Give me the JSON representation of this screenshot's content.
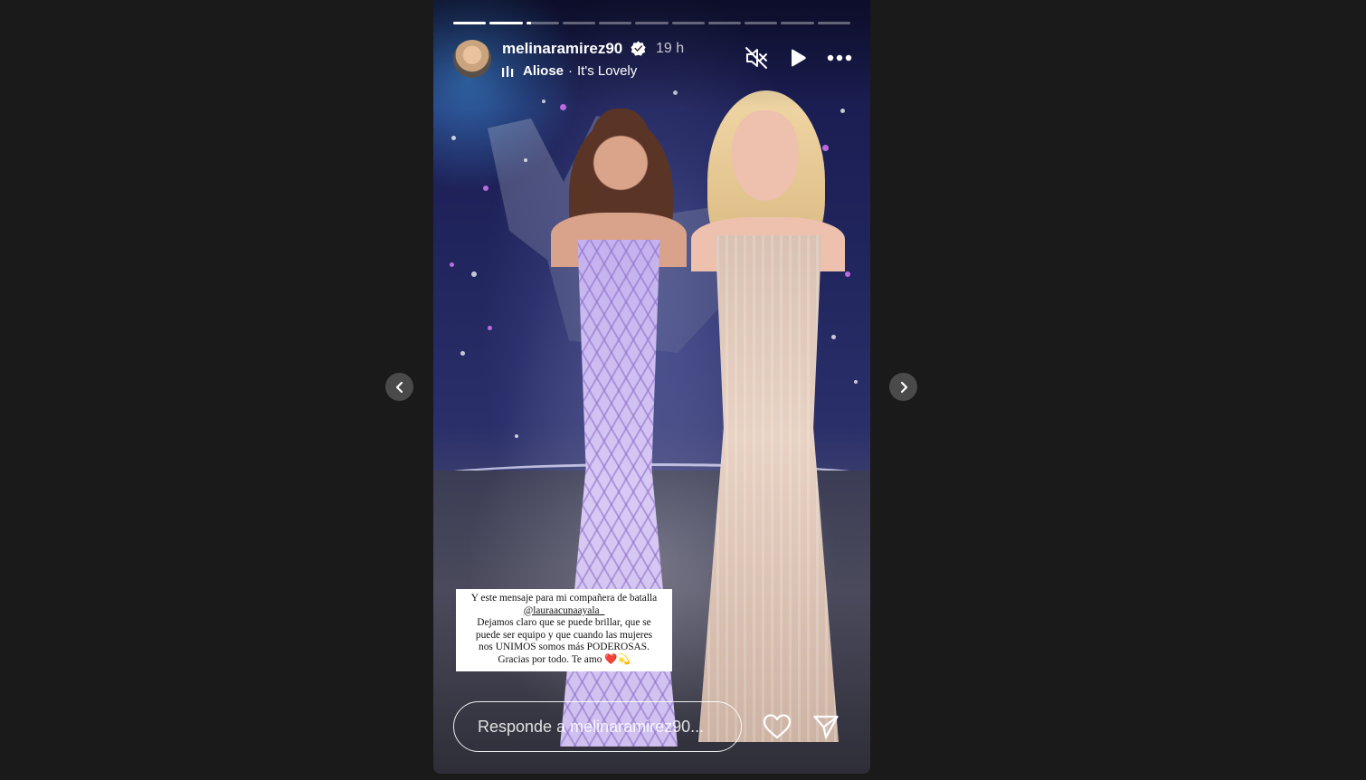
{
  "story": {
    "progress": {
      "segment_count": 11,
      "segments_completed": 2,
      "current_segment_fraction": 0.15
    },
    "header": {
      "username": "melinaramirez90",
      "verified": true,
      "time_ago": "19 h",
      "music": {
        "artist": "Aliose",
        "separator": "·",
        "song": "It's Lovely"
      }
    },
    "controls": {
      "mute_icon": "speaker-muted-icon",
      "play_icon": "play-icon",
      "more_icon": "more-horizontal-icon"
    },
    "caption": {
      "line1": "Y este mensaje para mi compañera de batalla",
      "mention": "@lauraacunaayala_",
      "line3": "Dejamos claro que se puede brillar, que se",
      "line4": "puede ser equipo y que cuando las mujeres",
      "line5": "nos UNIMOS somos más PODEROSAS.",
      "line6": "Gracias por todo. Te amo ❤️💫"
    },
    "reply": {
      "placeholder": "Responde a melinaramirez90..."
    },
    "actions": {
      "like_icon": "heart-icon",
      "share_icon": "paper-plane-icon"
    }
  },
  "navigation": {
    "prev_icon": "chevron-left-icon",
    "next_icon": "chevron-right-icon"
  },
  "colors": {
    "page_background": "#1a1a1a",
    "nav_button": "#4a4a4a",
    "caption_background": "#ffffff"
  }
}
